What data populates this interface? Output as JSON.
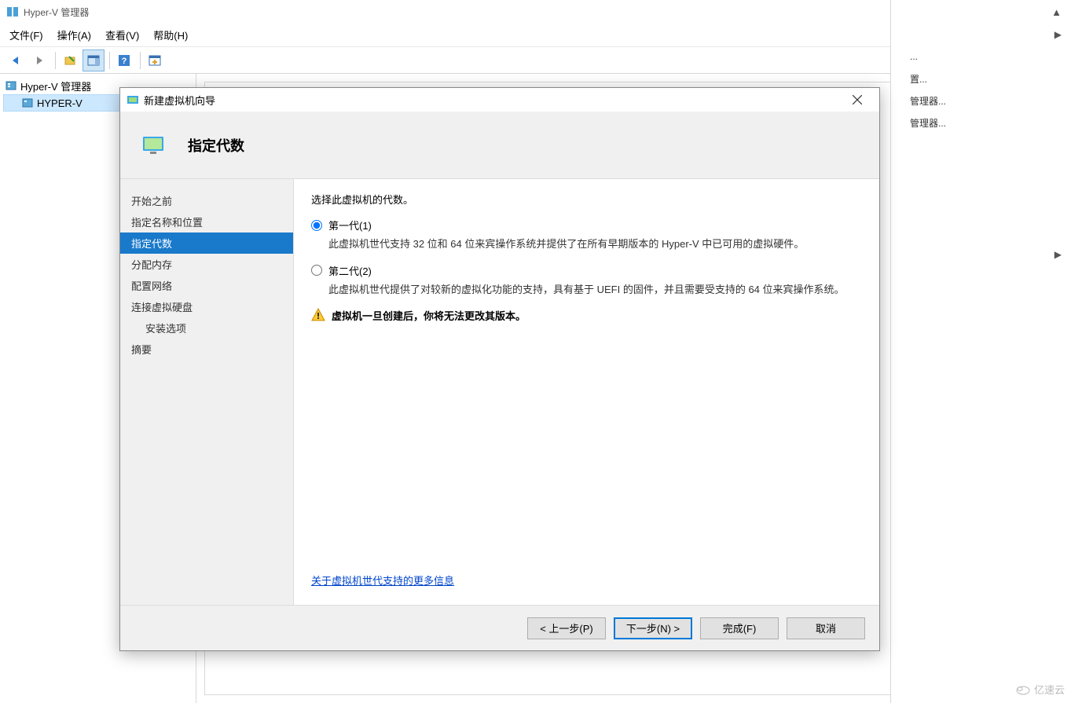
{
  "window": {
    "title": "Hyper-V 管理器"
  },
  "menubar": {
    "file": "文件(F)",
    "action": "操作(A)",
    "view": "查看(V)",
    "help": "帮助(H)"
  },
  "tree": {
    "root": "Hyper-V 管理器",
    "child": "HYPER-V"
  },
  "actions": {
    "item1": "...",
    "item2": "置...",
    "item3": "管理器...",
    "item4": "管理器..."
  },
  "dialog": {
    "title": "新建虚拟机向导",
    "header": "指定代数",
    "nav": {
      "before_start": "开始之前",
      "name_location": "指定名称和位置",
      "generation": "指定代数",
      "memory": "分配内存",
      "network": "配置网络",
      "disk": "连接虚拟硬盘",
      "install": "安装选项",
      "summary": "摘要"
    },
    "content": {
      "intro": "选择此虚拟机的代数。",
      "gen1_label": "第一代(1)",
      "gen1_desc": "此虚拟机世代支持 32 位和 64 位来宾操作系统并提供了在所有早期版本的 Hyper-V 中已可用的虚拟硬件。",
      "gen2_label": "第二代(2)",
      "gen2_desc": "此虚拟机世代提供了对较新的虚拟化功能的支持，具有基于 UEFI 的固件，并且需要受支持的 64 位来宾操作系统。",
      "warning": "虚拟机一旦创建后，你将无法更改其版本。",
      "more_link": "关于虚拟机世代支持的更多信息"
    },
    "buttons": {
      "prev": "< 上一步(P)",
      "next": "下一步(N) >",
      "finish": "完成(F)",
      "cancel": "取消"
    }
  },
  "watermark": "亿速云"
}
